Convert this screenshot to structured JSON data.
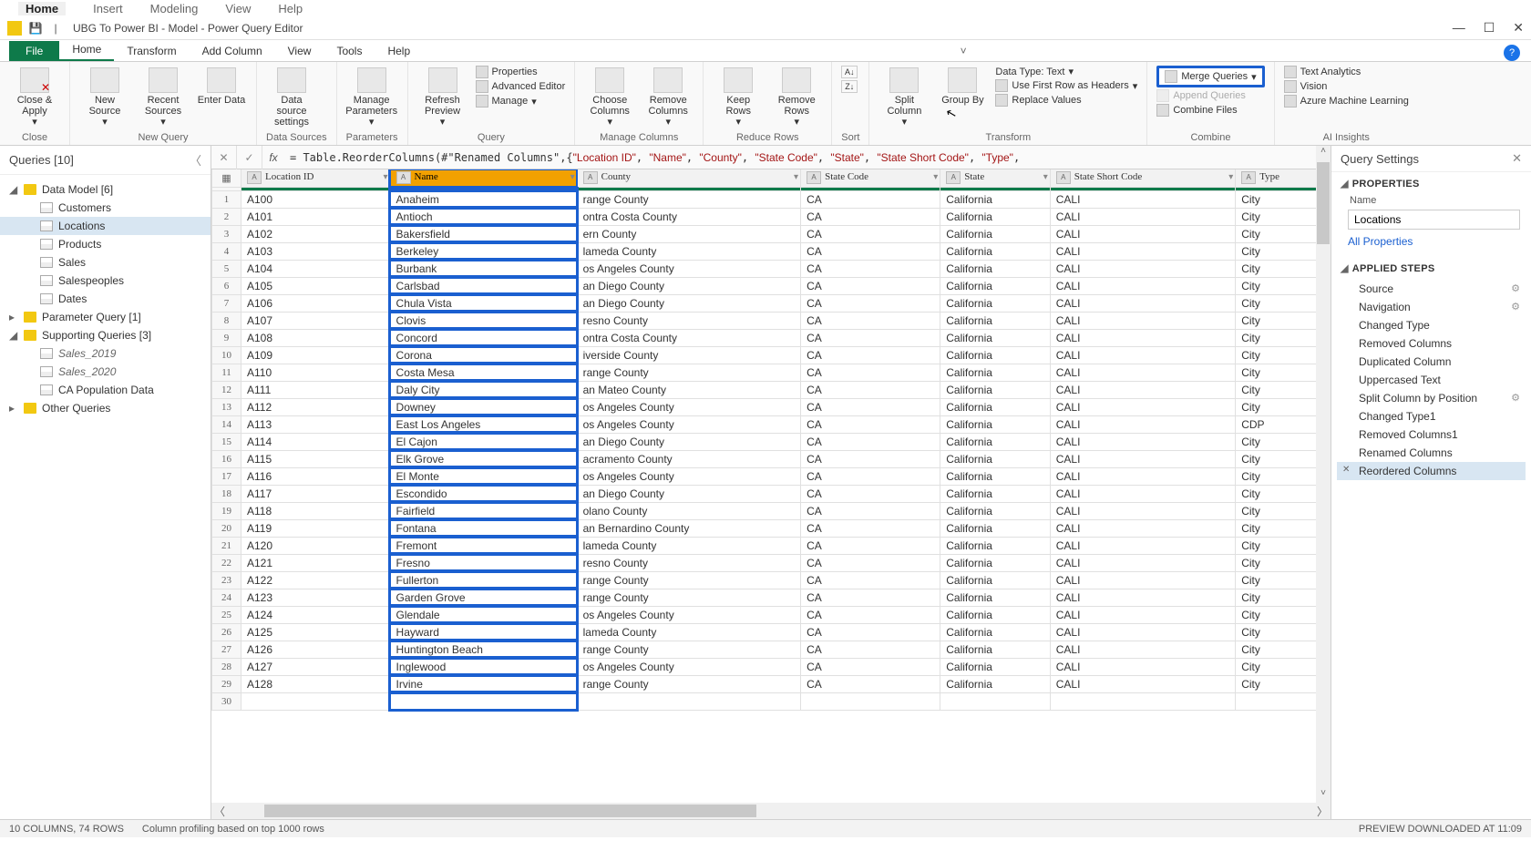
{
  "host_menu": {
    "items": [
      "Home",
      "Insert",
      "Modeling",
      "View",
      "Help"
    ],
    "active": 0
  },
  "window": {
    "title": "UBG To Power BI - Model - Power Query Editor",
    "min": "—",
    "max": "☐",
    "close": "✕"
  },
  "ribbon_tabs": {
    "file": "File",
    "items": [
      "Home",
      "Transform",
      "Add Column",
      "View",
      "Tools",
      "Help"
    ],
    "active": 0
  },
  "ribbon": {
    "close": {
      "close_apply": "Close &\nApply",
      "group": "Close"
    },
    "newquery": {
      "new_source": "New\nSource",
      "recent_sources": "Recent\nSources",
      "enter_data": "Enter\nData",
      "group": "New Query"
    },
    "datasources": {
      "settings": "Data source\nsettings",
      "group": "Data Sources"
    },
    "parameters": {
      "manage": "Manage\nParameters",
      "group": "Parameters"
    },
    "query": {
      "refresh": "Refresh\nPreview",
      "properties": "Properties",
      "advanced": "Advanced Editor",
      "manage": "Manage",
      "group": "Query"
    },
    "managecols": {
      "choose": "Choose\nColumns",
      "remove": "Remove\nColumns",
      "group": "Manage Columns"
    },
    "reducerows": {
      "keep": "Keep\nRows",
      "remove": "Remove\nRows",
      "group": "Reduce Rows"
    },
    "sort": {
      "group": "Sort"
    },
    "transform": {
      "split": "Split\nColumn",
      "groupby": "Group\nBy",
      "datatype": "Data Type: Text",
      "firstrow": "Use First Row as Headers",
      "replace": "Replace Values",
      "group": "Transform"
    },
    "combine": {
      "merge": "Merge Queries",
      "append": "Append Queries",
      "combinefiles": "Combine Files",
      "group": "Combine"
    },
    "ai": {
      "text": "Text Analytics",
      "vision": "Vision",
      "ml": "Azure Machine Learning",
      "group": "AI Insights"
    }
  },
  "formula": {
    "prefix": "= Table.ReorderColumns(#\"Renamed Columns\",{",
    "args": [
      "\"Location ID\"",
      "\"Name\"",
      "\"County\"",
      "\"State Code\"",
      "\"State\"",
      "\"State Short Code\"",
      "\"Type\""
    ],
    "suffix": ","
  },
  "queries_pane": {
    "title": "Queries [10]",
    "groups": [
      {
        "name": "Data Model [6]",
        "expanded": true,
        "items": [
          "Customers",
          "Locations",
          "Products",
          "Sales",
          "Salespeoples",
          "Dates"
        ],
        "selected": "Locations"
      },
      {
        "name": "Parameter Query [1]",
        "expanded": false,
        "items": []
      },
      {
        "name": "Supporting Queries [3]",
        "expanded": true,
        "items": [
          "Sales_2019",
          "Sales_2020",
          "CA Population Data"
        ],
        "italic": [
          0,
          1
        ]
      },
      {
        "name": "Other Queries",
        "expanded": false,
        "items": []
      }
    ]
  },
  "grid": {
    "columns": [
      "Location ID",
      "Name",
      "County",
      "State Code",
      "State",
      "State Short Code",
      "Type"
    ],
    "selected_col": 1,
    "rows": [
      [
        "A100",
        "Anaheim",
        "range County",
        "CA",
        "California",
        "CALI",
        "City"
      ],
      [
        "A101",
        "Antioch",
        "ontra Costa County",
        "CA",
        "California",
        "CALI",
        "City"
      ],
      [
        "A102",
        "Bakersfield",
        "ern County",
        "CA",
        "California",
        "CALI",
        "City"
      ],
      [
        "A103",
        "Berkeley",
        "lameda County",
        "CA",
        "California",
        "CALI",
        "City"
      ],
      [
        "A104",
        "Burbank",
        "os Angeles County",
        "CA",
        "California",
        "CALI",
        "City"
      ],
      [
        "A105",
        "Carlsbad",
        "an Diego County",
        "CA",
        "California",
        "CALI",
        "City"
      ],
      [
        "A106",
        "Chula Vista",
        "an Diego County",
        "CA",
        "California",
        "CALI",
        "City"
      ],
      [
        "A107",
        "Clovis",
        "resno County",
        "CA",
        "California",
        "CALI",
        "City"
      ],
      [
        "A108",
        "Concord",
        "ontra Costa County",
        "CA",
        "California",
        "CALI",
        "City"
      ],
      [
        "A109",
        "Corona",
        "iverside County",
        "CA",
        "California",
        "CALI",
        "City"
      ],
      [
        "A110",
        "Costa Mesa",
        "range County",
        "CA",
        "California",
        "CALI",
        "City"
      ],
      [
        "A111",
        "Daly City",
        "an Mateo County",
        "CA",
        "California",
        "CALI",
        "City"
      ],
      [
        "A112",
        "Downey",
        "os Angeles County",
        "CA",
        "California",
        "CALI",
        "City"
      ],
      [
        "A113",
        "East Los Angeles",
        "os Angeles County",
        "CA",
        "California",
        "CALI",
        "CDP"
      ],
      [
        "A114",
        "El Cajon",
        "an Diego County",
        "CA",
        "California",
        "CALI",
        "City"
      ],
      [
        "A115",
        "Elk Grove",
        "acramento County",
        "CA",
        "California",
        "CALI",
        "City"
      ],
      [
        "A116",
        "El Monte",
        "os Angeles County",
        "CA",
        "California",
        "CALI",
        "City"
      ],
      [
        "A117",
        "Escondido",
        "an Diego County",
        "CA",
        "California",
        "CALI",
        "City"
      ],
      [
        "A118",
        "Fairfield",
        "olano County",
        "CA",
        "California",
        "CALI",
        "City"
      ],
      [
        "A119",
        "Fontana",
        "an Bernardino County",
        "CA",
        "California",
        "CALI",
        "City"
      ],
      [
        "A120",
        "Fremont",
        "lameda County",
        "CA",
        "California",
        "CALI",
        "City"
      ],
      [
        "A121",
        "Fresno",
        "resno County",
        "CA",
        "California",
        "CALI",
        "City"
      ],
      [
        "A122",
        "Fullerton",
        "range County",
        "CA",
        "California",
        "CALI",
        "City"
      ],
      [
        "A123",
        "Garden Grove",
        "range County",
        "CA",
        "California",
        "CALI",
        "City"
      ],
      [
        "A124",
        "Glendale",
        "os Angeles County",
        "CA",
        "California",
        "CALI",
        "City"
      ],
      [
        "A125",
        "Hayward",
        "lameda County",
        "CA",
        "California",
        "CALI",
        "City"
      ],
      [
        "A126",
        "Huntington Beach",
        "range County",
        "CA",
        "California",
        "CALI",
        "City"
      ],
      [
        "A127",
        "Inglewood",
        "os Angeles County",
        "CA",
        "California",
        "CALI",
        "City"
      ],
      [
        "A128",
        "Irvine",
        "range County",
        "CA",
        "California",
        "CALI",
        "City"
      ]
    ]
  },
  "settings": {
    "title": "Query Settings",
    "properties": "PROPERTIES",
    "name_label": "Name",
    "name_value": "Locations",
    "all_props": "All Properties",
    "applied": "APPLIED STEPS",
    "steps": [
      {
        "n": "Source",
        "gear": true
      },
      {
        "n": "Navigation",
        "gear": true
      },
      {
        "n": "Changed Type"
      },
      {
        "n": "Removed Columns"
      },
      {
        "n": "Duplicated Column"
      },
      {
        "n": "Uppercased Text"
      },
      {
        "n": "Split Column by Position",
        "gear": true
      },
      {
        "n": "Changed Type1"
      },
      {
        "n": "Removed Columns1"
      },
      {
        "n": "Renamed Columns"
      },
      {
        "n": "Reordered Columns",
        "sel": true
      }
    ]
  },
  "status": {
    "left": "10 COLUMNS, 74 ROWS",
    "mid": "Column profiling based on top 1000 rows",
    "right": "PREVIEW DOWNLOADED AT 11:09"
  }
}
